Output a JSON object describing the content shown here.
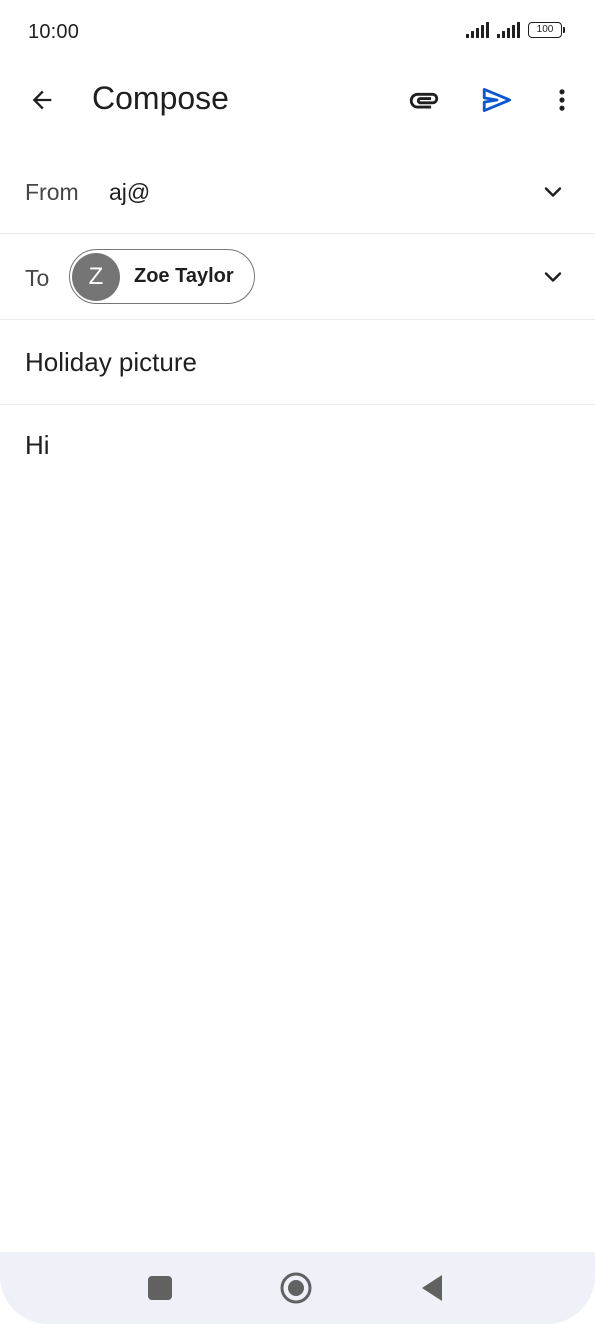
{
  "status_bar": {
    "time": "10:00",
    "battery": "100",
    "icons": [
      "signal-icon",
      "signal-icon",
      "battery-icon"
    ]
  },
  "app_bar": {
    "title": "Compose",
    "icons": [
      "back-arrow-icon",
      "paperclip-icon",
      "send-icon",
      "more-vert-icon"
    ],
    "send_color": "#0b57d0"
  },
  "from": {
    "label": "From",
    "value": "aj@"
  },
  "to": {
    "label": "To",
    "recipients": [
      {
        "initial": "Z",
        "name": "Zoe Taylor"
      }
    ]
  },
  "subject": {
    "value": "Holiday picture"
  },
  "body": {
    "value": "Hi"
  },
  "nav_bar": {
    "icons": [
      "recents-icon",
      "home-icon",
      "back-triangle-icon"
    ]
  }
}
